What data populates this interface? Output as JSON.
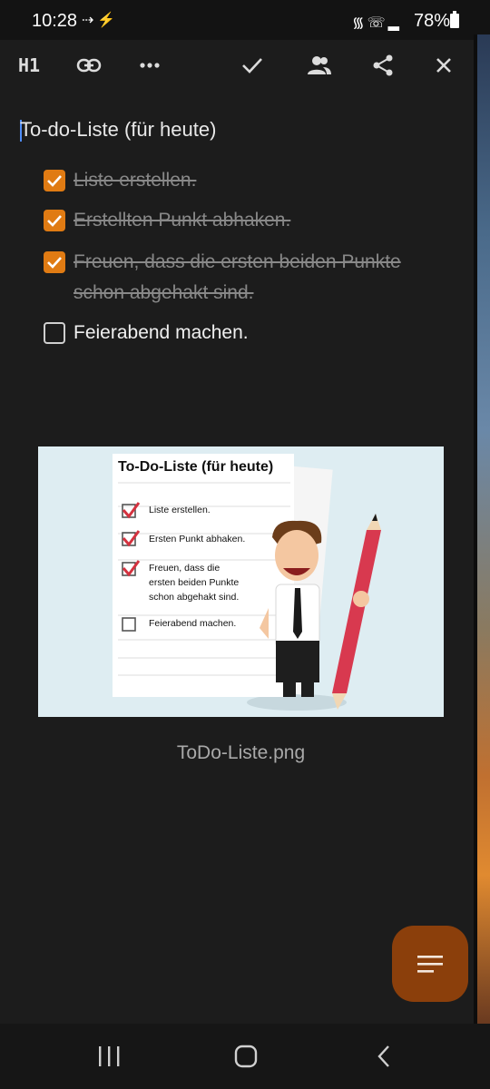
{
  "status_bar": {
    "time": "10:28",
    "battery_percent": "78%",
    "icons_left": [
      "data-saver-icon",
      "bolt-icon"
    ],
    "icons_right": [
      "wifi-icon",
      "wifi-call-icon",
      "signal-icon",
      "battery-icon"
    ]
  },
  "toolbar": {
    "heading_label": "H1",
    "icons": [
      "link-icon",
      "more-icon",
      "check-icon",
      "share-people-icon",
      "share-icon",
      "close-icon"
    ]
  },
  "note": {
    "title": "To-do-Liste (für heute)",
    "items": [
      {
        "text": "Liste erstellen.",
        "checked": true
      },
      {
        "text": "Erstellten Punkt abhaken.",
        "checked": true
      },
      {
        "text": "Freuen, dass die ersten beiden Punkte schon abgehakt sind.",
        "checked": true
      },
      {
        "text": "Feierabend machen.",
        "checked": false
      }
    ],
    "image_caption": "ToDo-Liste.png"
  },
  "embedded_image": {
    "title": "To-Do-Liste (für heute)",
    "items": [
      {
        "text": "Liste erstellen.",
        "checked": true
      },
      {
        "text": "Ersten Punkt abhaken.",
        "checked": true
      },
      {
        "text": "Freuen, dass die",
        "checked": true
      },
      {
        "text": "ersten beiden Punkte",
        "checked": null
      },
      {
        "text": "schon abgehakt sind.",
        "checked": null
      },
      {
        "text": "Feierabend machen.",
        "checked": false
      }
    ]
  },
  "colors": {
    "accent": "#e07b13",
    "fab": "#8b3f0b",
    "background": "#1c1c1c"
  },
  "fab": {
    "icon": "format-lines-icon"
  },
  "navigation": {
    "icons": [
      "recent-apps-icon",
      "home-icon",
      "back-icon"
    ]
  }
}
